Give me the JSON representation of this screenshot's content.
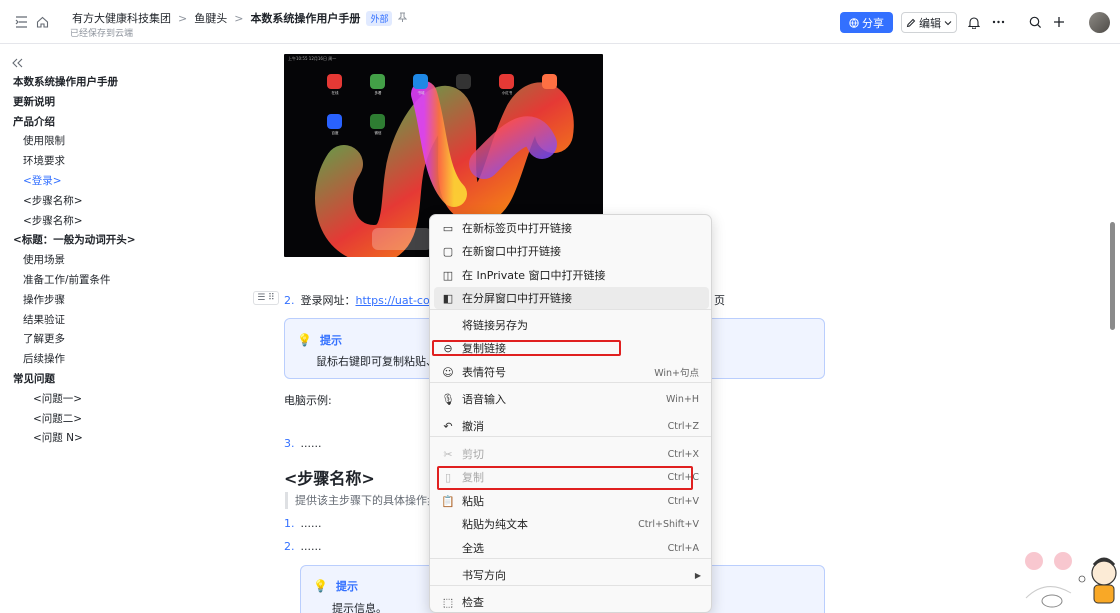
{
  "header": {
    "breadcrumbs": [
      "有方大健康科技集团",
      "鱼腱头",
      "本数系统操作用户手册"
    ],
    "badge": "外部",
    "saved_status": "已经保存到云端",
    "share_label": "分享",
    "edit_label": "编辑"
  },
  "sidebar": {
    "toc": [
      {
        "label": "本数系统操作用户手册",
        "level": 1
      },
      {
        "label": "更新说明",
        "level": 1
      },
      {
        "label": "产品介绍",
        "level": 1
      },
      {
        "label": "使用限制",
        "level": 2
      },
      {
        "label": "环境要求",
        "level": 2
      },
      {
        "label": "<登录>",
        "level": 2,
        "active": true
      },
      {
        "label": "<步骤名称>",
        "level": 2
      },
      {
        "label": "<步骤名称>",
        "level": 2
      },
      {
        "label": "<标题：一般为动词开头>",
        "level": 1
      },
      {
        "label": "使用场景",
        "level": 2
      },
      {
        "label": "准备工作/前置条件",
        "level": 2
      },
      {
        "label": "操作步骤",
        "level": 2
      },
      {
        "label": "结果验证",
        "level": 2
      },
      {
        "label": "了解更多",
        "level": 2
      },
      {
        "label": "后续操作",
        "level": 2
      },
      {
        "label": "常见问题",
        "level": 1
      },
      {
        "label": "<问题一>",
        "level": 3
      },
      {
        "label": "<问题二>",
        "level": 3
      },
      {
        "label": "<问题 N>",
        "level": 3
      }
    ]
  },
  "content": {
    "screenshot": {
      "status": "上午10:55 12月16日 周一",
      "apps": [
        {
          "label": "在线",
          "color": "#e53935"
        },
        {
          "label": "多看",
          "color": "#43a047"
        },
        {
          "label": "书城",
          "color": "#1e88e5"
        },
        {
          "label": "",
          "color": "#333333"
        },
        {
          "label": "小红书",
          "color": "#e53935"
        },
        {
          "label": "",
          "color": "#ff7043"
        },
        {
          "label": "百度",
          "color": "#2962ff"
        },
        {
          "label": "微信",
          "color": "#2e7d32"
        }
      ]
    },
    "step2_num": "2.",
    "step2_label": "登录网址：",
    "step2_link": "https://uat-cons",
    "step2_suffix": "页",
    "tip_title": "提示",
    "tip_body": "鼠标右键即可复制粘贴、",
    "pc_example": "电脑示例:",
    "step3_num": "3.",
    "step3_text": "......",
    "section_title": "<步骤名称>",
    "section_desc": "提供该主步骤下的具体操作步",
    "sub1_num": "1.",
    "sub1_text": "......",
    "sub2_num": "2.",
    "sub2_text": "......",
    "tip2_title": "提示",
    "tip2_body": "提示信息。"
  },
  "context_menu": {
    "items": [
      {
        "label": "在新标签页中打开链接",
        "icon": "new-tab-icon",
        "shortcut": ""
      },
      {
        "label": "在新窗口中打开链接",
        "icon": "new-window-icon",
        "shortcut": ""
      },
      {
        "label": "在 InPrivate 窗口中打开链接",
        "icon": "inprivate-icon",
        "shortcut": ""
      },
      {
        "label": "在分屏窗口中打开链接",
        "icon": "split-screen-icon",
        "shortcut": ""
      },
      {
        "label": "将链接另存为",
        "icon": "",
        "shortcut": ""
      },
      {
        "label": "复制链接",
        "icon": "link-icon",
        "shortcut": ""
      },
      {
        "label": "表情符号",
        "icon": "emoji-icon",
        "shortcut": "Win+句点"
      },
      {
        "label": "语音输入",
        "icon": "microphone-icon",
        "shortcut": "Win+H"
      },
      {
        "label": "撤消",
        "icon": "undo-icon",
        "shortcut": "Ctrl+Z"
      },
      {
        "label": "剪切",
        "icon": "scissors-icon",
        "shortcut": "Ctrl+X"
      },
      {
        "label": "复制",
        "icon": "copy-icon",
        "shortcut": "Ctrl+C"
      },
      {
        "label": "粘贴",
        "icon": "paste-icon",
        "shortcut": "Ctrl+V"
      },
      {
        "label": "粘贴为纯文本",
        "icon": "",
        "shortcut": "Ctrl+Shift+V"
      },
      {
        "label": "全选",
        "icon": "",
        "shortcut": "Ctrl+A"
      },
      {
        "label": "书写方向",
        "icon": "",
        "shortcut": ""
      },
      {
        "label": "检查",
        "icon": "inspect-icon",
        "shortcut": ""
      }
    ]
  },
  "colors": {
    "accent": "#3370ff",
    "highlight_box": "#e02020"
  }
}
